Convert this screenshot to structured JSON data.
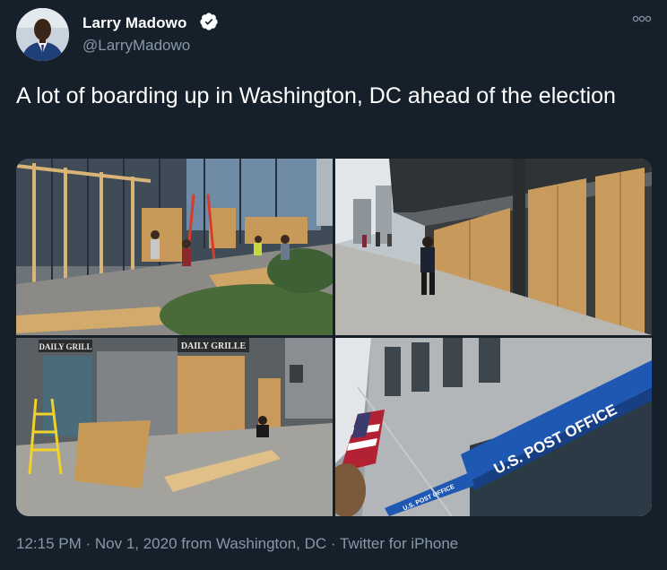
{
  "author": {
    "name": "Larry Madowo",
    "handle": "@LarryMadowo",
    "verified_icon": "verified-badge-icon"
  },
  "tweet": {
    "text": "A lot of boarding up in Washington, DC ahead of the election"
  },
  "photos": {
    "p1_sign": "",
    "p2_sign": "",
    "p3_sign": "DAILY GRILLE",
    "p4_sign": "U.S. POST OFFICE"
  },
  "meta": {
    "time": "12:15 PM",
    "sep1": " · ",
    "date": "Nov 1, 2020",
    "from_label": " from ",
    "location": "Washington, DC",
    "sep2": " · ",
    "source": "Twitter for iPhone"
  },
  "colors": {
    "background": "#15202b",
    "secondary_text": "#8899a6",
    "verified": "#ffffff"
  }
}
